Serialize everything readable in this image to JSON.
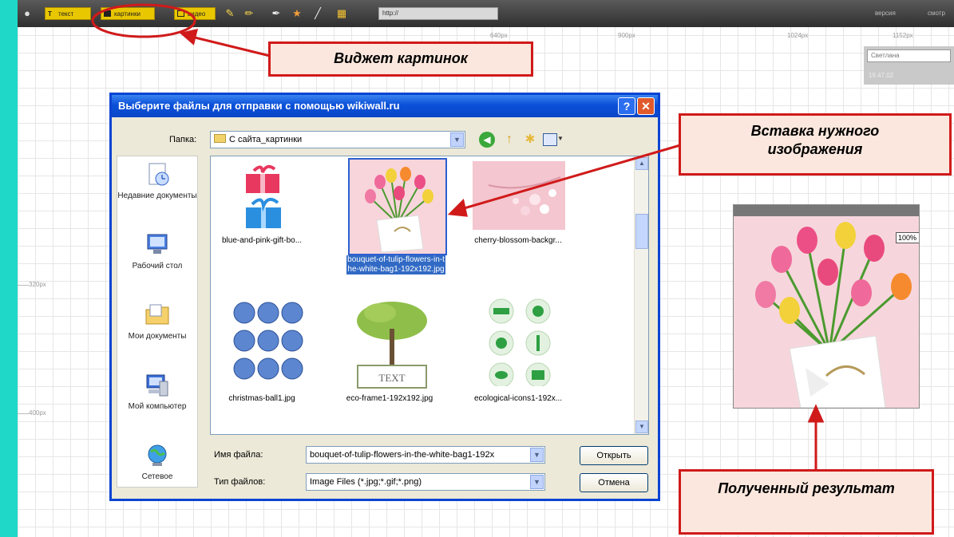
{
  "toolbar": {
    "text_button": "текст",
    "image_button": "картинки",
    "third_button": "видео",
    "url_value": "http://",
    "right_label_1": "версия",
    "right_label_2": "смотр"
  },
  "ruler": {
    "h_labels": [
      "640px",
      "900px",
      "1024px",
      "1152px"
    ],
    "v_labels": [
      "320px",
      "400px"
    ]
  },
  "side_panel": {
    "input_value": "Светлана",
    "text": "19.47.02"
  },
  "dialog": {
    "title": "Выберите файлы для отправки с помощью wikiwall.ru",
    "folder_label": "Папка:",
    "folder_value": "С сайта_картинки",
    "places": [
      {
        "label": "Недавние документы",
        "icon": "recent-documents-icon"
      },
      {
        "label": "Рабочий стол",
        "icon": "desktop-icon"
      },
      {
        "label": "Мои документы",
        "icon": "my-documents-icon"
      },
      {
        "label": "Мой компьютер",
        "icon": "my-computer-icon"
      },
      {
        "label": "Сетевое",
        "icon": "network-icon"
      }
    ],
    "files": [
      {
        "name": "blue-and-pink-gift-bo...",
        "icon": "gift-boxes-icon"
      },
      {
        "name": "bouquet-of-tulip-flowers-in-the-white-bag1-192x192.jpg",
        "icon": "tulip-bouquet-icon",
        "selected": true
      },
      {
        "name": "cherry-blossom-backgr...",
        "icon": "cherry-blossom-icon"
      },
      {
        "name": "christmas-ball1.jpg",
        "icon": "christmas-balls-icon"
      },
      {
        "name": "eco-frame1-192x192.jpg",
        "icon": "eco-frame-icon"
      },
      {
        "name": "ecological-icons1-192x...",
        "icon": "ecological-icons-icon"
      }
    ],
    "eco_frame_text": "TEXT",
    "filename_label": "Имя файла:",
    "filename_value": "bouquet-of-tulip-flowers-in-the-white-bag1-192x",
    "filetype_label": "Тип файлов:",
    "filetype_value": "Image Files (*.jpg;*.gif;*.png)",
    "open_button": "Открыть",
    "cancel_button": "Отмена"
  },
  "preview": {
    "zoom": "100%"
  },
  "callouts": {
    "widget": "Виджет картинок",
    "insert": "Вставка нужного изображения",
    "result": "Полученный результат"
  },
  "colors": {
    "callout_border": "#d01a1a",
    "callout_fill": "#fbe7dd",
    "dialog_blue": "#0a44d2",
    "page_bg": "#1fd8c8"
  }
}
